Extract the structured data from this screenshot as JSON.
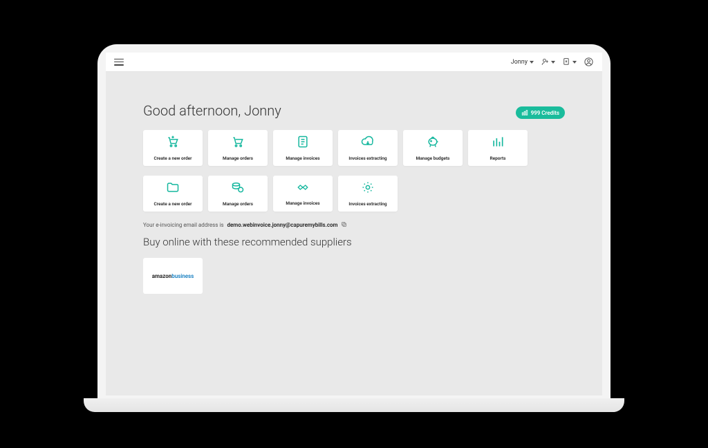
{
  "header": {
    "user_label": "Jonny"
  },
  "greeting": "Good afternoon, Jonny",
  "credits": {
    "label": "999 Credits"
  },
  "tiles_row1": [
    {
      "label": "Create a new order",
      "icon": "cart-plus"
    },
    {
      "label": "Manage orders",
      "icon": "cart"
    },
    {
      "label": "Manage invoices",
      "icon": "document"
    },
    {
      "label": "Invoices extracting",
      "icon": "cloud-down"
    },
    {
      "label": "Manage budgets",
      "icon": "piggy"
    },
    {
      "label": "Reports",
      "icon": "bars"
    }
  ],
  "tiles_row2": [
    {
      "label": "Create a new order",
      "icon": "folder"
    },
    {
      "label": "Manage orders",
      "icon": "coin-stack"
    },
    {
      "label": "Manage invoices",
      "icon": "handshake"
    },
    {
      "label": "Invoices extracting",
      "icon": "gear"
    }
  ],
  "einvoice": {
    "prefix": "Your e-invoicing email address is",
    "address": "demo.webinvoice.jonny@capuremybills.com"
  },
  "suppliers_title": "Buy online with these recommended suppliers",
  "suppliers": [
    {
      "brand_a": "amazon",
      "brand_b": "business"
    }
  ]
}
